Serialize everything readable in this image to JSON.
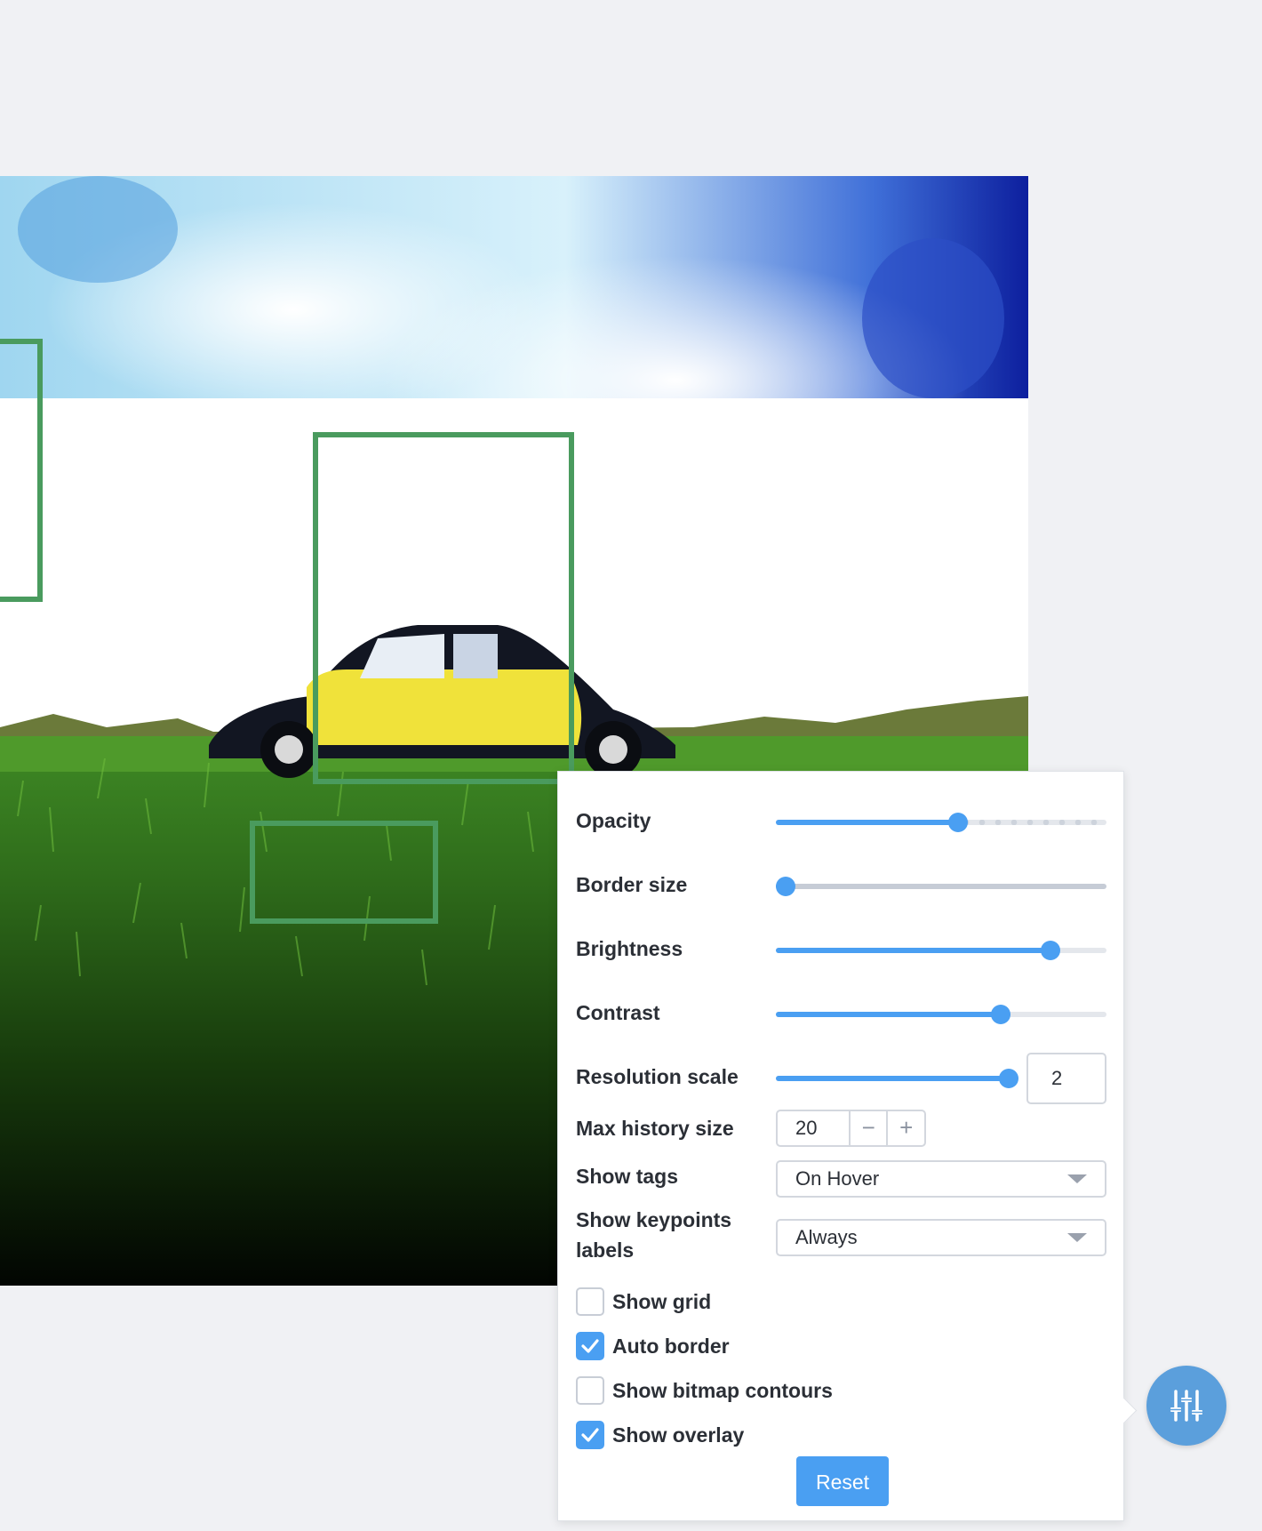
{
  "settings": {
    "opacity": {
      "label": "Opacity",
      "value_fraction": 0.55
    },
    "border_size": {
      "label": "Border size",
      "value_fraction": 0.03
    },
    "brightness": {
      "label": "Brightness",
      "value_fraction": 0.83
    },
    "contrast": {
      "label": "Contrast",
      "value_fraction": 0.68
    },
    "resolution_scale": {
      "label": "Resolution scale",
      "value": "2",
      "value_fraction": 1.0
    },
    "max_history_size": {
      "label": "Max history size",
      "value": "20",
      "decrement": "−",
      "increment": "+"
    },
    "show_tags": {
      "label": "Show tags",
      "selected": "On Hover"
    },
    "show_keypoints_labels": {
      "label_line1": "Show keypoints",
      "label_line2": "labels",
      "selected": "Always"
    },
    "checkboxes": [
      {
        "label": "Show grid",
        "checked": false
      },
      {
        "label": "Auto border",
        "checked": true
      },
      {
        "label": "Show bitmap contours",
        "checked": false
      },
      {
        "label": "Show overlay",
        "checked": true
      }
    ],
    "reset_label": "Reset"
  },
  "annotations": {
    "count": 3,
    "color": "#4a9b5e"
  },
  "colors": {
    "accent": "#4a9ff2",
    "fab": "#5b9fdc",
    "background": "#f0f1f4"
  },
  "icons": {
    "fab": "sliders-icon",
    "check": "check-icon"
  }
}
